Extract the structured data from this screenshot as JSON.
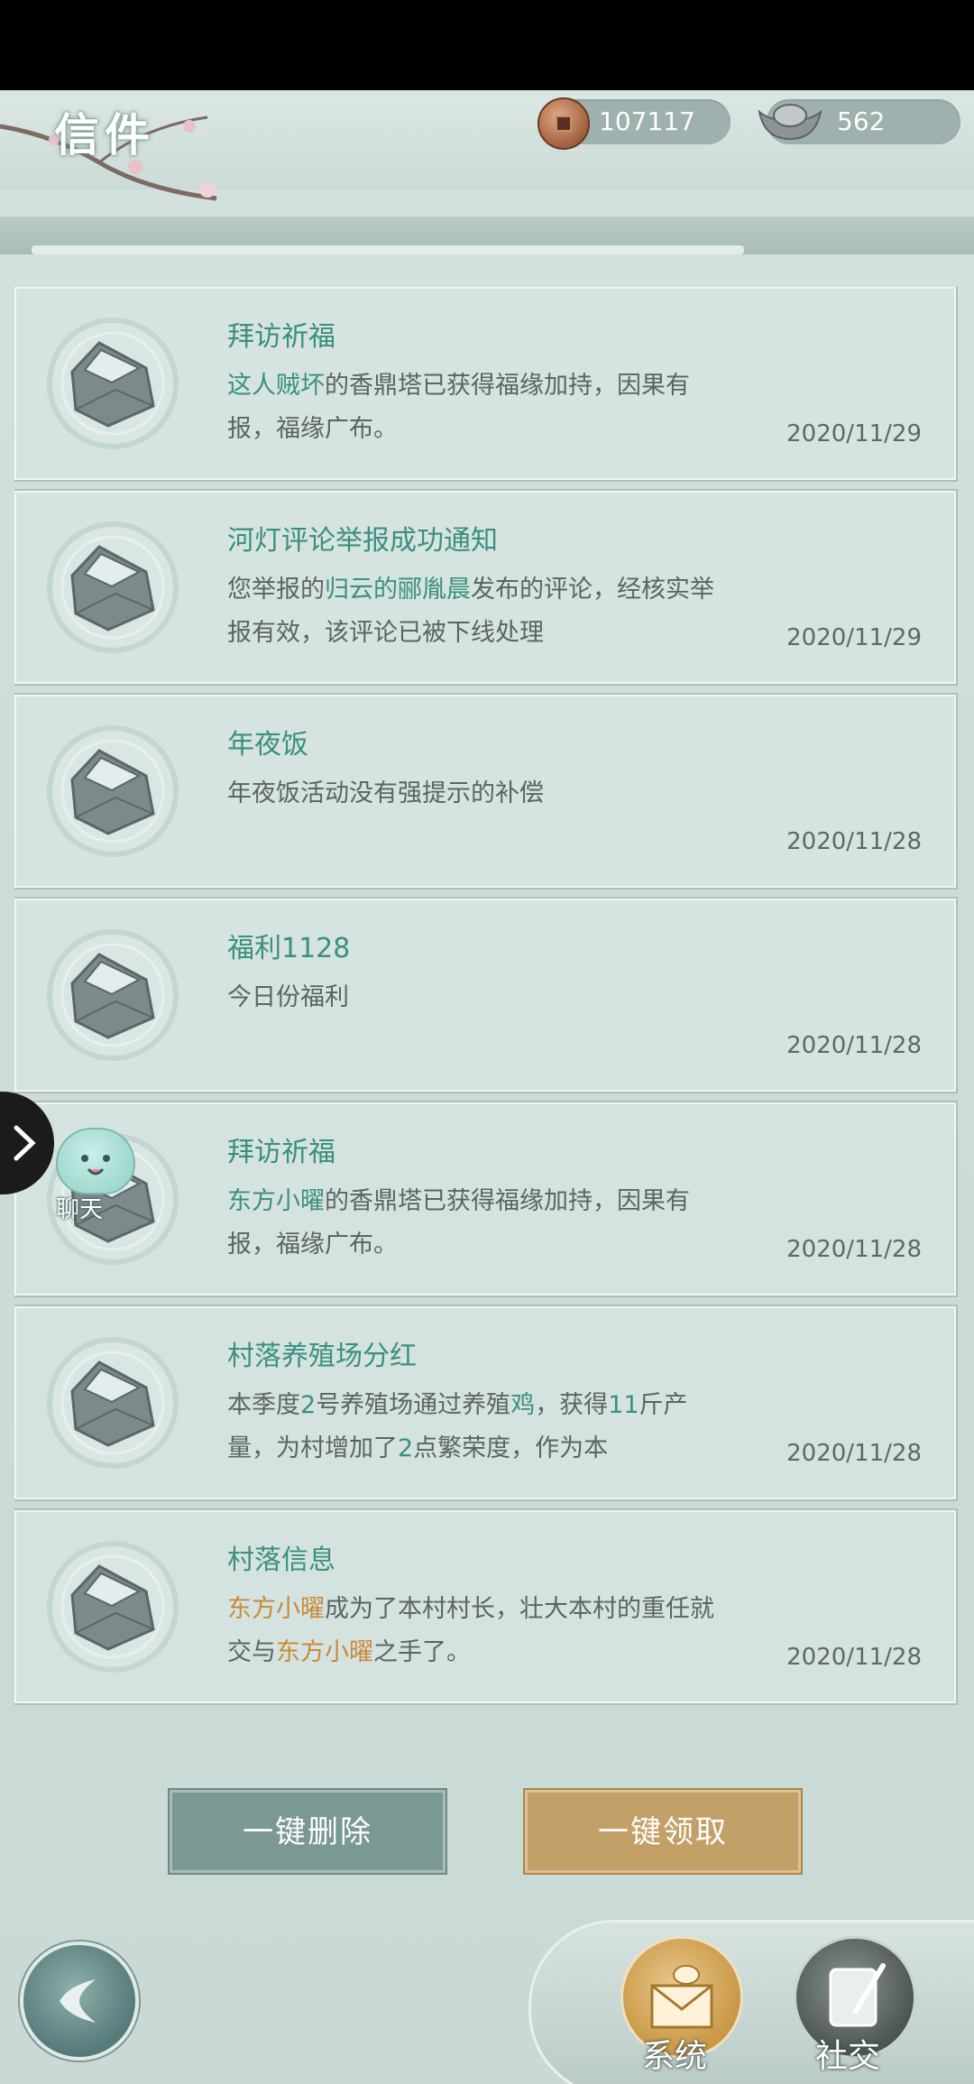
{
  "header": {
    "title": "信件",
    "copper": "107117",
    "silver": "562"
  },
  "mails": [
    {
      "title": "拜访祈福",
      "body": [
        {
          "t": "这人贼坏",
          "c": "g"
        },
        {
          "t": "的香鼎塔已获得福缘加持，因果有报，福缘广布。",
          "c": ""
        }
      ],
      "date": "2020/11/29"
    },
    {
      "title": "河灯评论举报成功通知",
      "body": [
        {
          "t": "您举报的",
          "c": ""
        },
        {
          "t": "归云的郦胤晨",
          "c": "g"
        },
        {
          "t": "发布的评论，经核实举报有效，该评论已被下线处理",
          "c": ""
        }
      ],
      "date": "2020/11/29"
    },
    {
      "title": "年夜饭",
      "body": [
        {
          "t": "年夜饭活动没有强提示的补偿",
          "c": ""
        }
      ],
      "date": "2020/11/28"
    },
    {
      "title": "福利1128",
      "body": [
        {
          "t": "今日份福利",
          "c": ""
        }
      ],
      "date": "2020/11/28"
    },
    {
      "title": "拜访祈福",
      "body": [
        {
          "t": "东方小曜",
          "c": "g"
        },
        {
          "t": "的香鼎塔已获得福缘加持，因果有报，福缘广布。",
          "c": ""
        }
      ],
      "date": "2020/11/28"
    },
    {
      "title": "村落养殖场分红",
      "body": [
        {
          "t": "本季度",
          "c": ""
        },
        {
          "t": "2",
          "c": "g"
        },
        {
          "t": "号养殖场通过养殖",
          "c": ""
        },
        {
          "t": "鸡",
          "c": "g"
        },
        {
          "t": "，获得",
          "c": ""
        },
        {
          "t": "11",
          "c": "g"
        },
        {
          "t": "斤产量，为村增加了",
          "c": ""
        },
        {
          "t": "2",
          "c": "g"
        },
        {
          "t": "点繁荣度，作为本",
          "c": ""
        }
      ],
      "date": "2020/11/28"
    },
    {
      "title": "村落信息",
      "body": [
        {
          "t": "东方小曜",
          "c": "o"
        },
        {
          "t": "成为了本村村长，壮大本村的重任就交与",
          "c": ""
        },
        {
          "t": "东方小曜",
          "c": "o"
        },
        {
          "t": "之手了。",
          "c": ""
        }
      ],
      "date": "2020/11/28"
    }
  ],
  "chat_label": "聊天",
  "buttons": {
    "delete_all": "一键删除",
    "claim_all": "一键领取"
  },
  "tabs": {
    "system": "系统",
    "social": "社交"
  },
  "icons": {
    "back": "back-arrow-icon",
    "envelope": "open-envelope-icon",
    "chat": "chat-face-icon",
    "expand": "chevron-right-icon"
  }
}
